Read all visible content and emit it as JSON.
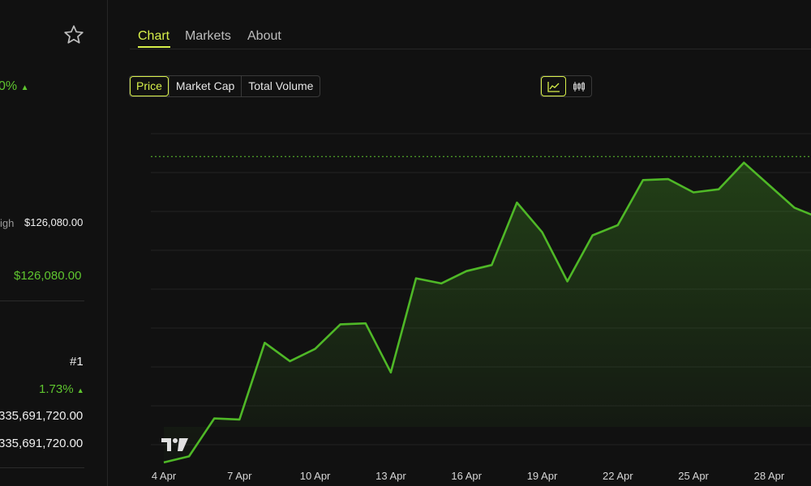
{
  "sidebar": {
    "change_percent": "0%",
    "high_label": "igh",
    "high_value": "$126,080.00",
    "ath_value": "$126,080.00",
    "rank": "#1",
    "rank_change": "1.73%",
    "supply_1": "335,691,720.00",
    "supply_2": "335,691,720.00",
    "up_arrow": "▲"
  },
  "tabs": [
    {
      "label": "Chart"
    },
    {
      "label": "Markets"
    },
    {
      "label": "About"
    }
  ],
  "metric_tabs": [
    {
      "label": "Price"
    },
    {
      "label": "Market Cap"
    },
    {
      "label": "Total Volume"
    }
  ],
  "chart_type_icons": [
    "line-chart-icon",
    "candlestick-icon"
  ],
  "colors": {
    "accent": "#d8f04a",
    "positive": "#5fc52f",
    "line": "#4fb827",
    "background": "#111111"
  },
  "chart_data": {
    "type": "area",
    "x_tick_labels": [
      "4 Apr",
      "7 Apr",
      "10 Apr",
      "13 Apr",
      "16 Apr",
      "19 Apr",
      "22 Apr",
      "25 Apr",
      "28 Apr"
    ],
    "x": [
      4,
      5,
      6,
      7,
      8,
      9,
      10,
      11,
      12,
      13,
      14,
      15,
      16,
      17,
      18,
      19,
      20,
      21,
      22,
      23,
      24,
      25,
      26,
      27,
      28,
      29,
      30
    ],
    "values": [
      83300,
      83900,
      87600,
      87500,
      95000,
      93200,
      94400,
      96800,
      96900,
      92100,
      101300,
      100800,
      102000,
      102600,
      108700,
      105800,
      101000,
      105500,
      106500,
      110900,
      111000,
      109700,
      110000,
      112600,
      110400,
      108200,
      107200
    ],
    "reference_value": 113200,
    "ylim": [
      81000,
      119000
    ],
    "grid": true,
    "watermark": "TV"
  }
}
